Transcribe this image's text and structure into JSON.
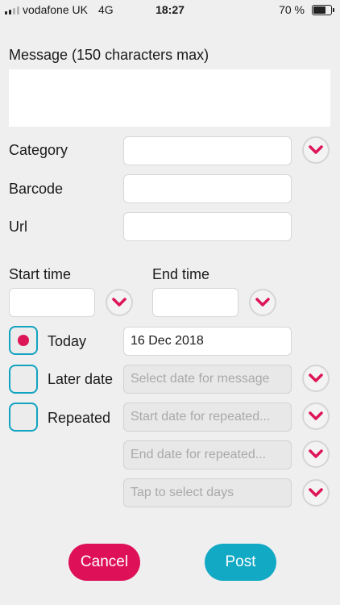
{
  "status_bar": {
    "carrier": "vodafone UK",
    "network": "4G",
    "time": "18:27",
    "battery": "70 %",
    "battery_level": 0.7
  },
  "message": {
    "label": "Message (150 characters max)",
    "value": ""
  },
  "category": {
    "label": "Category",
    "value": ""
  },
  "barcode": {
    "label": "Barcode",
    "value": ""
  },
  "url": {
    "label": "Url",
    "value": ""
  },
  "start_time": {
    "label": "Start time",
    "value": ""
  },
  "end_time": {
    "label": "End time",
    "value": ""
  },
  "today": {
    "label": "Today",
    "checked": true,
    "value": "16 Dec 2018"
  },
  "later_date": {
    "label": "Later date",
    "checked": false,
    "placeholder": "Select date for message"
  },
  "repeated": {
    "label": "Repeated",
    "checked": false,
    "start_placeholder": "Start date for repeated...",
    "end_placeholder": "End date for repeated...",
    "days_placeholder": "Tap to select days"
  },
  "actions": {
    "cancel": "Cancel",
    "post": "Post"
  },
  "colors": {
    "accent_pink": "#dd1657",
    "accent_teal": "#12a9c4",
    "background": "#efeff0"
  },
  "icons": {
    "dropdown": "chevron-down-icon",
    "radio": "radio-dot-icon"
  }
}
